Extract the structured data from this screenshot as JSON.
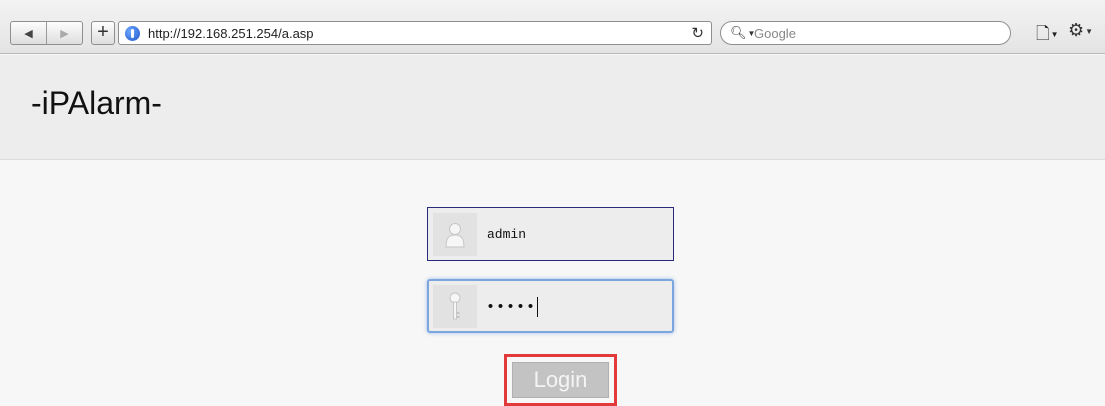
{
  "browser": {
    "back_icon": "back-arrow-icon",
    "forward_icon": "forward-arrow-icon",
    "add_icon": "plus-icon",
    "url": "http://192.168.251.254/a.asp",
    "search_placeholder": "Google"
  },
  "header": {
    "title": "-iPAlarm-"
  },
  "login": {
    "username_value": "admin",
    "password_value": "•••••",
    "button_label": "Login"
  },
  "colors": {
    "highlight": "#e23a3a",
    "focus": "#7aa5de",
    "username_border": "#2a2a7a"
  }
}
